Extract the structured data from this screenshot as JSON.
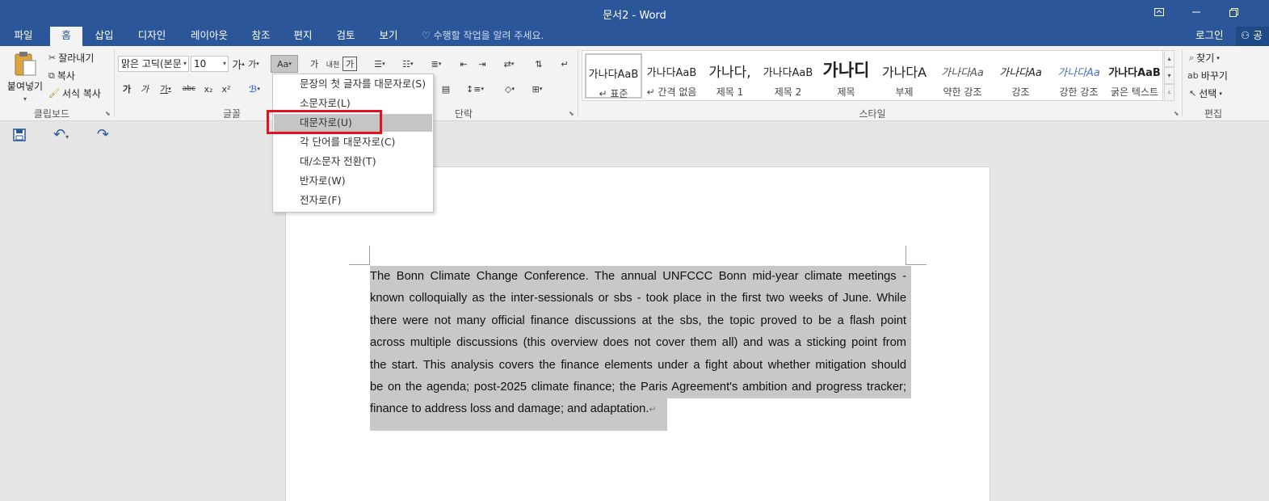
{
  "window": {
    "title": "문서2 - Word"
  },
  "tabs": [
    "파일",
    "홈",
    "삽입",
    "디자인",
    "레이아웃",
    "참조",
    "편지",
    "검토",
    "보기"
  ],
  "active_tab": "홈",
  "tell_me": "수행할 작업을 알려 주세요.",
  "account": {
    "login": "로그인",
    "share": "공"
  },
  "clipboard": {
    "paste": "붙여넣기",
    "cut": "잘라내기",
    "copy": "복사",
    "format_painter": "서식 복사",
    "label": "클립보드"
  },
  "font": {
    "name": "맑은 고딕(본문",
    "size": "10",
    "grow": "가",
    "shrink": "가",
    "change_case": "Aa",
    "clear": "가",
    "phonetic": "내천",
    "enclose": "가",
    "bold": "가",
    "italic": "가",
    "underline": "가",
    "strike": "abc",
    "subscript": "x₂",
    "superscript": "x²",
    "label": "글꼴"
  },
  "paragraph": {
    "label": "단락"
  },
  "styles": {
    "label": "스타일",
    "items": [
      {
        "preview": "가나다AaB",
        "name": "↵ 표준"
      },
      {
        "preview": "가나다AaB",
        "name": "↵ 간격 없음"
      },
      {
        "preview": "가나다,",
        "name": "제목 1"
      },
      {
        "preview": "가나다AaB",
        "name": "제목 2"
      },
      {
        "preview": "가나디",
        "name": "제목"
      },
      {
        "preview": "가나다A",
        "name": "부제"
      },
      {
        "preview": "가나다Aa",
        "name": "약한 강조"
      },
      {
        "preview": "가나다Aa",
        "name": "강조"
      },
      {
        "preview": "가나다Aa",
        "name": "강한 강조"
      },
      {
        "preview": "가나다AaB",
        "name": "굵은 텍스트"
      }
    ]
  },
  "editing": {
    "find": "찾기",
    "replace": "바꾸기",
    "select": "선택",
    "label": "편집"
  },
  "change_case_menu": [
    {
      "label": "문장의 첫 글자를 대문자로(S)"
    },
    {
      "label": "소문자로(L)"
    },
    {
      "label": "대문자로(U)"
    },
    {
      "label": "각 단어를 대문자로(C)"
    },
    {
      "label": "대/소문자 전환(T)"
    },
    {
      "label": "반자로(W)"
    },
    {
      "label": "전자로(F)"
    }
  ],
  "document": {
    "lines": [
      "The Bonn Climate Change Conference. The annual UNFCCC Bonn mid-year climate meetings -",
      "known colloquially as the inter-sessionals or sbs - took place in the first two weeks of June. While",
      "there were not many official finance discussions at the sbs, the topic proved to be a flash point",
      "across multiple discussions (this overview does not cover them all) and was a sticking point from",
      "the start. This analysis covers the finance elements under a fight about whether mitigation should",
      "be on the agenda; post-2025 climate finance; the Paris Agreement's ambition and progress tracker;",
      "finance to address loss and damage; and adaptation."
    ]
  },
  "colors": {
    "brand": "#2b579a",
    "ribbon": "#f3f3f3",
    "highlight": "#e0141e",
    "selection": "#c8c8c8"
  }
}
